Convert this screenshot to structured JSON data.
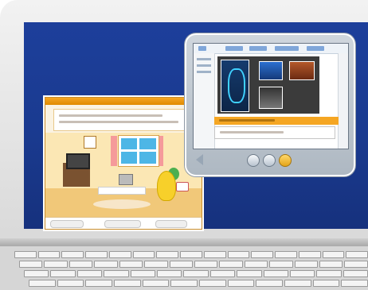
{
  "colors": {
    "desktop_background": "#1a3a8f",
    "left_window_accent": "#f5a623",
    "viewer_frame": "#aeb8c2",
    "viewer_accent": "#f5a623"
  },
  "icons": {
    "viewer_back": "back-arrow-icon",
    "viewer_button_1": "circle-button-icon",
    "viewer_button_2": "circle-button-icon",
    "viewer_button_3": "circle-button-icon"
  }
}
